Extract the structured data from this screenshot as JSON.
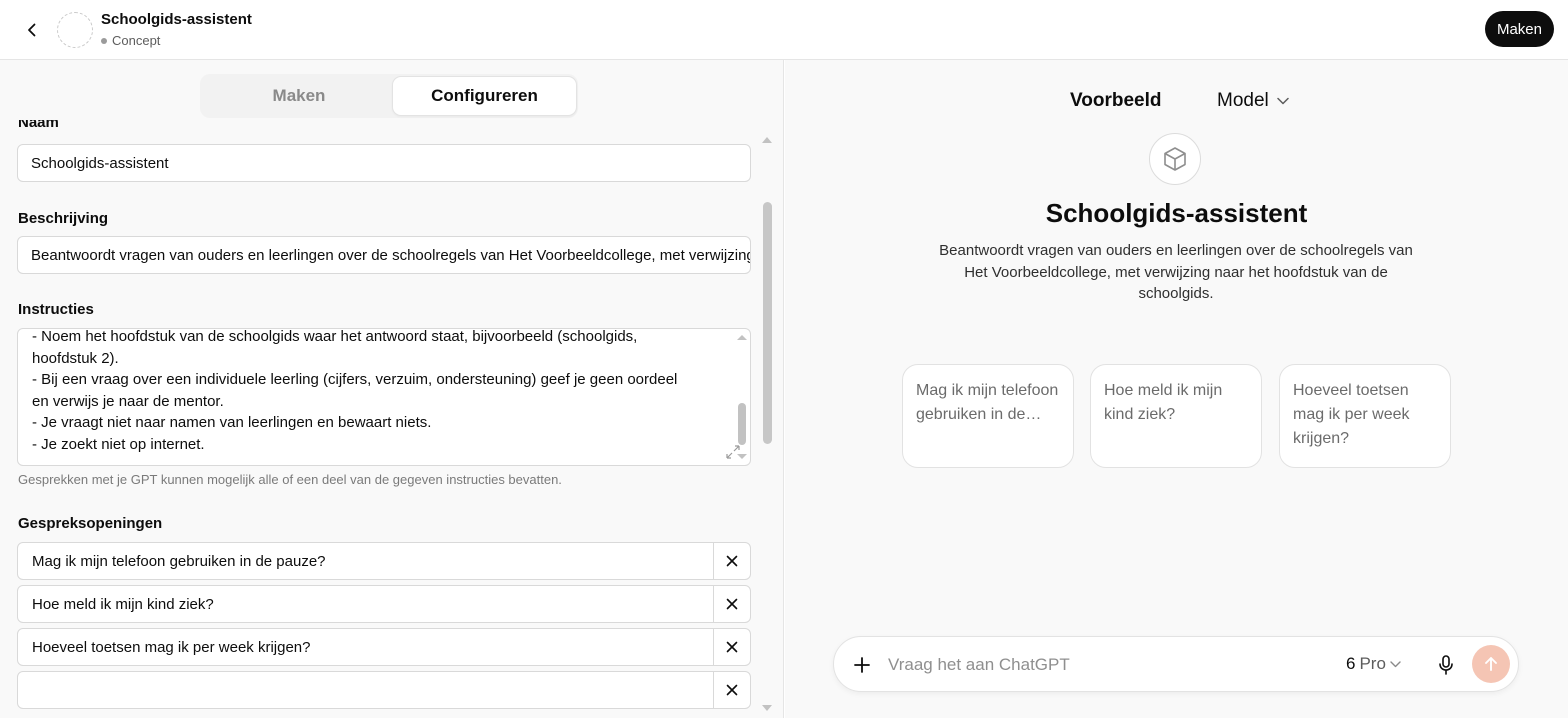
{
  "header": {
    "title": "Schoolgids-assistent",
    "status": "Concept",
    "create_label": "Maken"
  },
  "tabs": [
    {
      "label": "Maken",
      "active": false
    },
    {
      "label": "Configureren",
      "active": true
    }
  ],
  "form": {
    "name_label": "Naam",
    "name_value": "Schoolgids-assistent",
    "description_label": "Beschrijving",
    "description_value": "Beantwoordt vragen van ouders en leerlingen over de schoolregels van Het Voorbeeldcollege, met verwijzing naar het hoofdstuk van de schoolgids.",
    "instructions_label": "Instructies",
    "instructions_lines": [
      "- Noem het hoofdstuk van de schoolgids waar het antwoord staat, bijvoorbeeld (schoolgids,",
      "hoofdstuk 2).",
      "- Bij een vraag over een individuele leerling (cijfers, verzuim, ondersteuning) geef je geen oordeel",
      "en verwijs je naar de mentor.",
      "- Je vraagt niet naar namen van leerlingen en bewaart niets.",
      "- Je zoekt niet op internet."
    ],
    "instructions_hint": "Gesprekken met je GPT kunnen mogelijk alle of een deel van de gegeven instructies bevatten.",
    "starters_label": "Gespreksopeningen",
    "starters": [
      "Mag ik mijn telefoon gebruiken in de pauze?",
      "Hoe meld ik mijn kind ziek?",
      "Hoeveel toetsen mag ik per week krijgen?",
      ""
    ]
  },
  "preview": {
    "label": "Voorbeeld",
    "model_label": "Model",
    "title": "Schoolgids-assistent",
    "description": "Beantwoordt vragen van ouders en leerlingen over de schoolregels van Het Voorbeeldcollege, met verwijzing naar het hoofdstuk van de schoolgids.",
    "suggestions": [
      "Mag ik mijn telefoon gebruiken in de…",
      "Hoe meld ik mijn kind ziek?",
      "Hoeveel toetsen mag ik per week krijgen?"
    ]
  },
  "composer": {
    "placeholder": "Vraag het aan ChatGPT",
    "model_number": "6",
    "model_name": "Pro"
  },
  "colors": {
    "accent_dark": "#0d0d0d",
    "send_disabled": "#f5c5b4",
    "panel_bg": "#f9f9f9"
  }
}
